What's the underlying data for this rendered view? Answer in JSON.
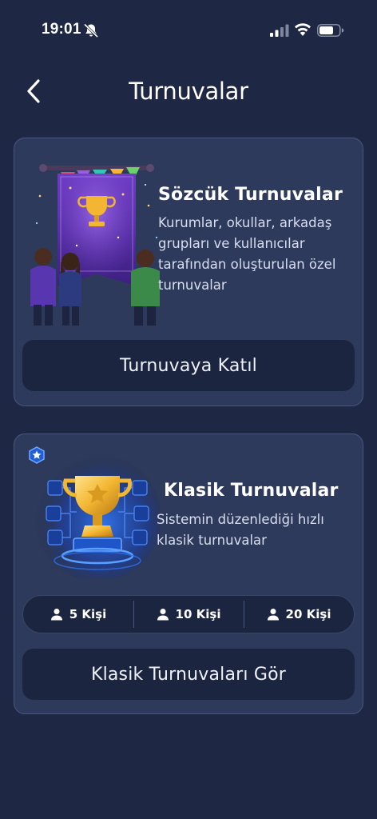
{
  "status_bar": {
    "time": "19:01",
    "icons": [
      "bell-off-icon",
      "signal-icon",
      "wifi-icon",
      "battery-icon"
    ]
  },
  "header": {
    "back_icon": "chevron-left-icon",
    "title": "Turnuvalar"
  },
  "cards": [
    {
      "title": "Sözcük Turnuvalar",
      "description": "Kurumlar, okullar, arkadaş grupları ve kullanıcılar tarafından oluşturulan özel turnuvalar",
      "illustration": "tournament-banner-illustration",
      "button_label": "Turnuvaya Katıl"
    },
    {
      "title": "Klasik Turnuvalar",
      "description": "Sistemin düzenlediği hızlı klasik turnuvalar",
      "illustration": "trophy-illustration",
      "size_options": [
        {
          "label": "5 Kişi",
          "icon": "person-icon"
        },
        {
          "label": "10 Kişi",
          "icon": "person-icon"
        },
        {
          "label": "20 Kişi",
          "icon": "person-icon"
        }
      ],
      "button_label": "Klasik Turnuvaları Gör"
    }
  ],
  "colors": {
    "background": "#1e2743",
    "card": "#2e3a5b",
    "card_border": "#4a5780",
    "button": "#1c2540",
    "text": "#ffffff",
    "trophy_gold": "#f2b632",
    "glow_blue": "#2f7bff"
  }
}
